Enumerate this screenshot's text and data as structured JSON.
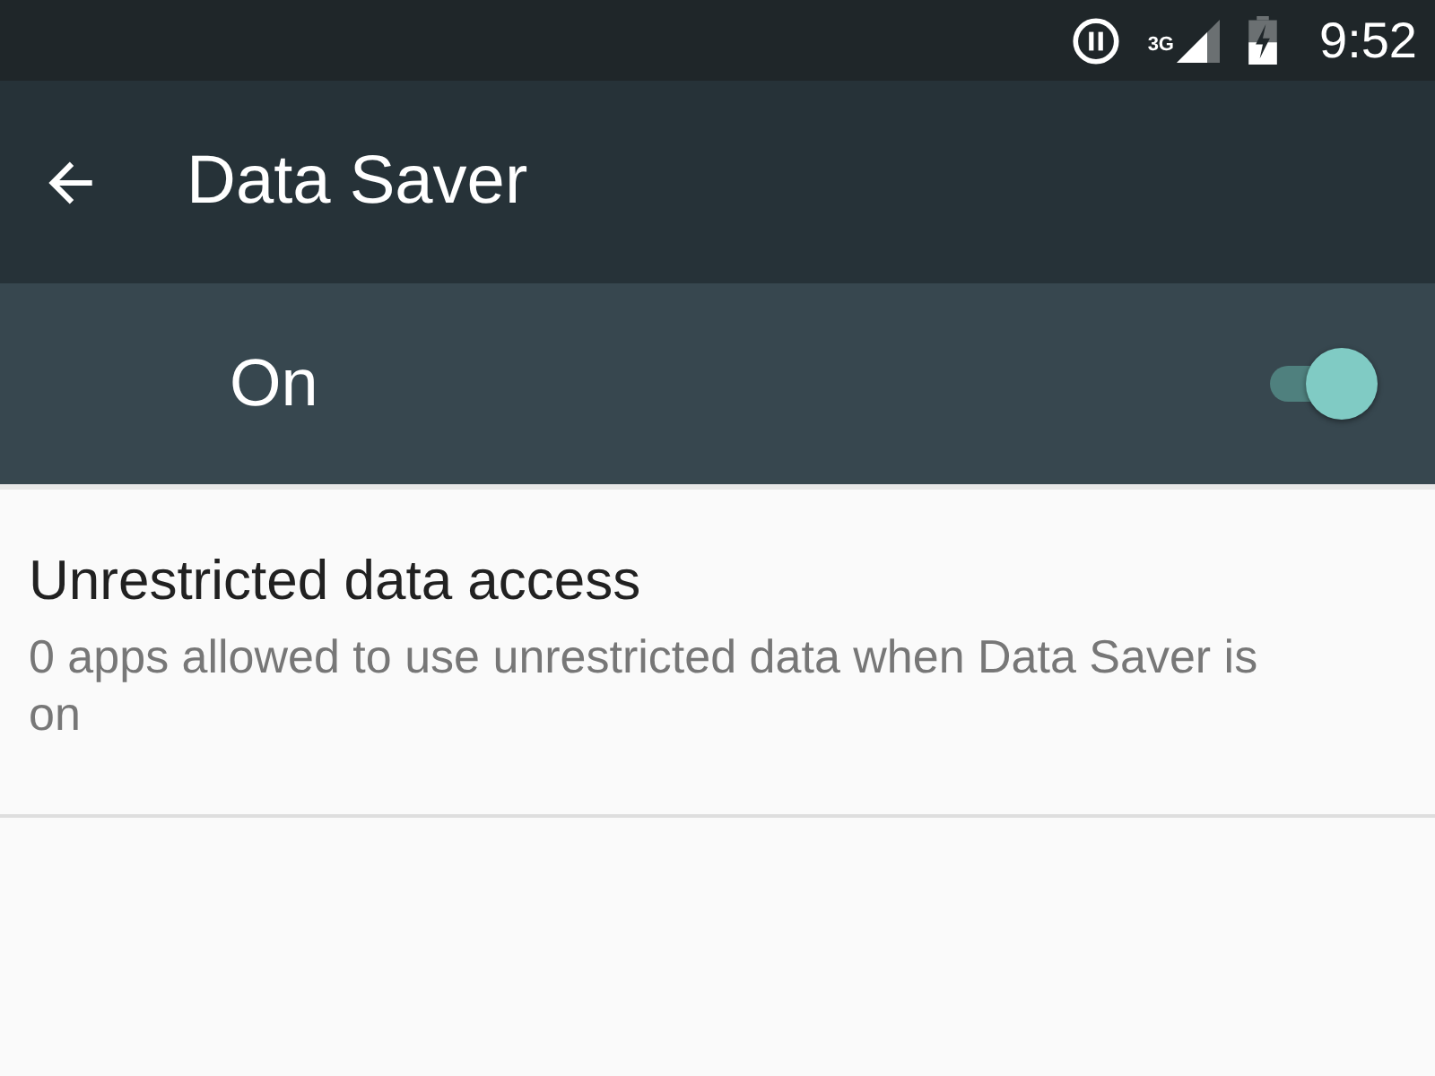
{
  "status_bar": {
    "network": "3G",
    "time": "9:52"
  },
  "toolbar": {
    "title": "Data Saver"
  },
  "master_switch": {
    "label": "On",
    "on": true
  },
  "items": [
    {
      "title": "Unrestricted data access",
      "summary": "0 apps allowed to use unrestricted data when Data Saver is on"
    }
  ]
}
